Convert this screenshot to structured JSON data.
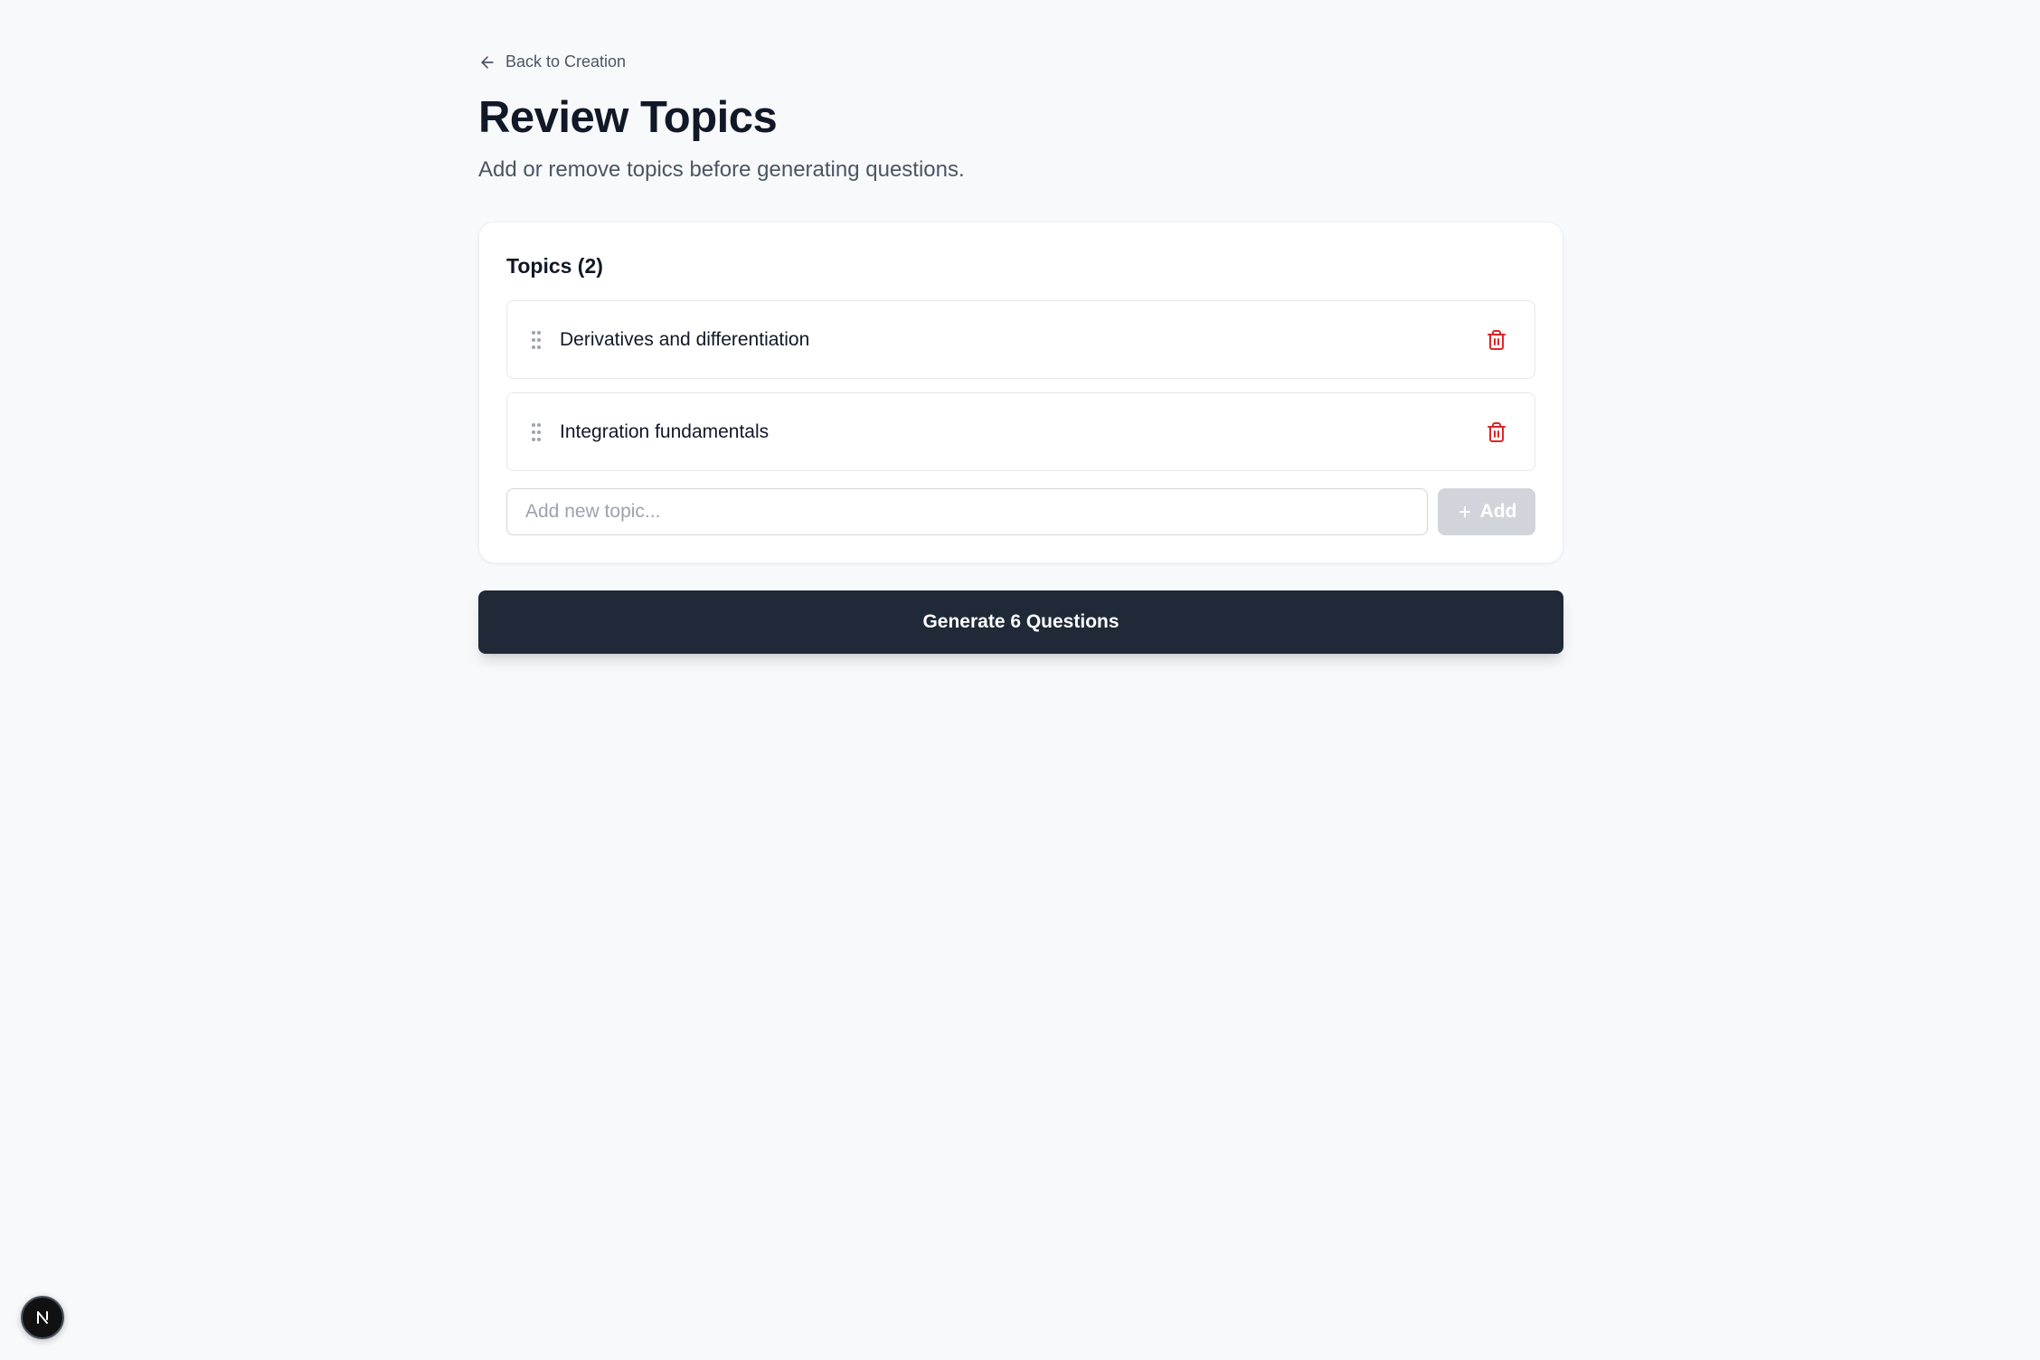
{
  "nav": {
    "back_label": "Back to Creation"
  },
  "header": {
    "title": "Review Topics",
    "subtitle": "Add or remove topics before generating questions."
  },
  "topics_card": {
    "title": "Topics (2)",
    "items": [
      {
        "label": "Derivatives and differentiation"
      },
      {
        "label": "Integration fundamentals"
      }
    ],
    "input": {
      "value": "",
      "placeholder": "Add new topic..."
    },
    "add_label": "Add"
  },
  "generate_label": "Generate 6 Questions",
  "colors": {
    "background": "#f8f9fb",
    "primary_button": "#1f2937",
    "delete_icon": "#dc2626",
    "disabled_button": "#d1d5db"
  },
  "icons": {
    "back": "arrow-left-icon",
    "drag": "grip-vertical-icon",
    "delete": "trash-icon",
    "add": "plus-icon",
    "dev_indicator": "next-logo-icon"
  }
}
